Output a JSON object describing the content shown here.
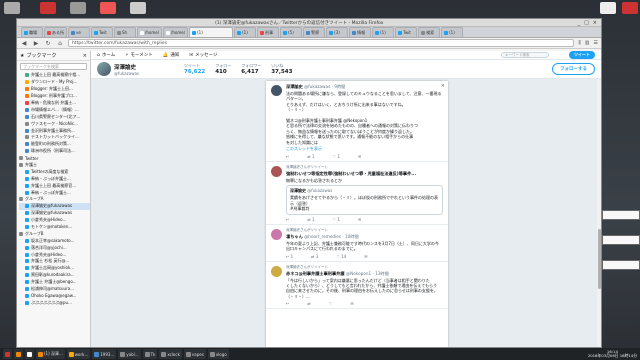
{
  "window": {
    "title": "(1) 深澤諭史@fukazawasさん／Twitterからの返信付きツイート - Mozilla Firefox"
  },
  "tabs": [
    {
      "label": "職場",
      "color": "#1da1f2"
    },
    {
      "label": "ある所",
      "color": "#e44"
    },
    {
      "label": "ve",
      "color": "#48c"
    },
    {
      "label": "Twit",
      "color": "#1da1f2"
    },
    {
      "label": "Sh",
      "color": "#888"
    },
    {
      "label": "/home/",
      "color": "#fff"
    },
    {
      "label": "/home/",
      "color": "#fff"
    },
    {
      "label": "(1)",
      "color": "#1da1f2",
      "active": true
    },
    {
      "label": "(1)",
      "color": "#1da1f2"
    },
    {
      "label": "刑事",
      "color": "#e44"
    },
    {
      "label": "(5)",
      "color": "#1da1f2"
    },
    {
      "label": "警察",
      "color": "#48c"
    },
    {
      "label": "(3)",
      "color": "#1da1f2"
    },
    {
      "label": "情報",
      "color": "#48c"
    },
    {
      "label": "(1)",
      "color": "#1da1f2"
    },
    {
      "label": "Twit",
      "color": "#1da1f2"
    },
    {
      "label": "検索",
      "color": "#888"
    },
    {
      "label": "(1)",
      "color": "#1da1f2"
    }
  ],
  "toolbar": {
    "url": "https://twitter.com/fukazawas/with_replies",
    "back": "◀",
    "forward": "▶",
    "reload": "↻",
    "home": "⌂"
  },
  "sidebar": {
    "title": "ブックマーク",
    "search_placeholder": "ブックマークを検索",
    "items": [
      {
        "label": "弁護士上田 最高検察庁相...",
        "color": "#4a8"
      },
      {
        "label": "ダウンロード - My Proj...",
        "color": "#fa0"
      },
      {
        "label": "Blogger: 弁護士上田...",
        "color": "#f70"
      },
      {
        "label": "Blogger: 刑事弁護ブロ...",
        "color": "#f70"
      },
      {
        "label": "奉納・危険な刑 弁護士...",
        "color": "#e44"
      },
      {
        "label": "市場情報エバ…（情報）...",
        "color": "#48c"
      },
      {
        "label": "石川県警察センター(北ア...",
        "color": "#48c"
      },
      {
        "label": "ヴァスモーク - NicoNic...",
        "color": "#888"
      },
      {
        "label": "金沢刑事弁護士事務所...",
        "color": "#48c"
      },
      {
        "label": "テストカットバックライ...",
        "color": "#888"
      },
      {
        "label": "能登町の刑務所対策...",
        "color": "#48c"
      },
      {
        "label": "珠洲市役所（刑事司法...",
        "color": "#48c"
      },
      {
        "label": "Twitter",
        "color": "#888",
        "folder": true
      },
      {
        "label": "弁護士",
        "color": "#888",
        "folder": true
      },
      {
        "label": "Twitterの高度な検索",
        "color": "#1da1f2"
      },
      {
        "label": "奉納・ぶっぽ弁護士...",
        "color": "#1da1f2"
      },
      {
        "label": "弁護士上田 最高検察官…",
        "color": "#1da1f2"
      },
      {
        "label": "奉納・ぶっぽ弁護士...",
        "color": "#1da1f2"
      },
      {
        "label": "グループA",
        "color": "#888",
        "folder": true
      },
      {
        "label": "深澤諭史@fukazawas",
        "color": "#1da1f2",
        "selected": true
      },
      {
        "label": "深澤諭史@fukazawas",
        "color": "#1da1f2"
      },
      {
        "label": "小倉秀夫@Hideo...",
        "color": "#1da1f2"
      },
      {
        "label": "モトケン@motoken...",
        "color": "#1da1f2"
      },
      {
        "label": "グループB",
        "color": "#888",
        "folder": true
      },
      {
        "label": "坂本正幸@sakamoto...",
        "color": "#1da1f2"
      },
      {
        "label": "落合洋司@yjochi...",
        "color": "#1da1f2"
      },
      {
        "label": "小倉秀夫@Hideo...",
        "color": "#1da1f2"
      },
      {
        "label": "弁護士 杉松 英行@...",
        "color": "#1da1f2"
      },
      {
        "label": "弁護士吉岡@yoshiok...",
        "color": "#1da1f2"
      },
      {
        "label": "黒田彰@kurodaakira...",
        "color": "#1da1f2"
      },
      {
        "label": "弁護士 弁護士@bengo...",
        "color": "#1da1f2"
      },
      {
        "label": "松浦伸司@matsuura...",
        "color": "#1da1f2"
      },
      {
        "label": "Ohoko Egawa@egaw...",
        "color": "#1da1f2"
      },
      {
        "label": "ぷぷぷぷぷぷぷ@pu...",
        "color": "#1da1f2"
      }
    ]
  },
  "twitter": {
    "nav": [
      {
        "icon": "⌂",
        "label": "ホーム"
      },
      {
        "icon": "⚡",
        "label": "モーメント"
      },
      {
        "icon": "🔔",
        "label": "通知"
      },
      {
        "icon": "✉",
        "label": "メッセージ"
      }
    ],
    "search_placeholder": "キーワード検索",
    "tweet_button": "ツイート",
    "profile": {
      "name": "深澤諭史",
      "handle": "@fukazawas",
      "stats": [
        {
          "label": "ツイート",
          "value": "76,622",
          "active": true
        },
        {
          "label": "フォロー",
          "value": "410"
        },
        {
          "label": "フォロワー",
          "value": "6,417"
        },
        {
          "label": "いいね",
          "value": "37,543"
        }
      ],
      "follow_button": "フォローする"
    },
    "thread_close": "×",
    "tweets": [
      {
        "context": "",
        "name": "深澤諭史",
        "meta": "@fukazawas · 9時間",
        "avatar": "#456",
        "body": "法の問題ある場所に嫌なら、登録してのキュウなることを思いまして、注意、一番現るパターン。\nとりあえず、だけはいく、とおちうけ所に出来る事はないですね。\n（・ゞ・）\n\n猫ネコ@刑事弁護士事刑事弁護 @Nekopon1\nと思る所で法律の交流を始めたものの、自種者への通報の対策に伝わりつ\nらく、無益な情報を送ったのに取てないほうことが何度か繰り返した。\n皆様にを得して、嫌な状態で思いです。通報不能のない相手からの仕事\nを対した知識には",
        "more": "このスレッドを表示",
        "actions": [
          "↩",
          "⇄ 1",
          "♡ 1",
          "✉"
        ]
      },
      {
        "context": "深澤諭史さんがリツイート",
        "name": "強制わいせつ等指定性罪(強制わいせつ罪・児童福祉法違反)等事件...",
        "meta": "",
        "avatar": "#a55",
        "body": "無罪になるかも応答されるとか",
        "quote": {
          "name": "深澤諭史",
          "meta": "@fukazawas",
          "body": "実績をあげさせてやるから（・ゞ）。ほぼ仮の刑務所でやれという事件の処理の表示（返答）\n#刑事裁判"
        },
        "actions": [
          "↩",
          "⇄ 1",
          "♡ 1",
          "✉"
        ]
      },
      {
        "context": "深澤諭史さんがリツイート",
        "name": "凛ちゃん",
        "meta": "@heart_remedies · 10時間",
        "avatar": "#c7a",
        "body": "今年の夏より上記、弁護士兼務可能です時代のンスを3月7日（土）、同日に大学の今\n出口キャンパスにて行われるのまでに。",
        "actions": [
          "↩ 1",
          "⇄ 3",
          "♡ 14",
          "✉"
        ]
      },
      {
        "context": "深澤諭史さんがリツイート",
        "name": "赤ネコ@刑事弁護士事刑事弁護",
        "meta": "@Nekopon1 · 13時間",
        "avatar": "#ca4",
        "body": "「今は行しいから」って案内は嫌悪に思ったんだけど（当事者は相手と関わりた\nくしたくないから）、どうしてもと言われたから、弁護士依頼で理由を伝えてもらう\n自由に来させたのに。その後、刑事の理由をお伝えしたのに怠らせは刑事の支援を。\n（・ゞ・）...",
        "actions": [
          "↩",
          "⇄",
          "♡",
          "✉"
        ]
      }
    ]
  },
  "taskbar": {
    "items": [
      {
        "label": "",
        "color": "#c33"
      },
      {
        "label": "",
        "color": "#e80"
      },
      {
        "label": "",
        "color": "#fff"
      },
      {
        "label": "(1) 深澤...",
        "color": "#e80"
      },
      {
        "label": "work...",
        "color": "#fa0"
      },
      {
        "label": "1993...",
        "color": "#48c"
      },
      {
        "label": "yabl...",
        "color": "#888"
      },
      {
        "label": "Tk",
        "color": "#888"
      },
      {
        "label": "xclock",
        "color": "#888"
      },
      {
        "label": "vapes",
        "color": "#888"
      },
      {
        "label": "xlogo",
        "color": "#888"
      }
    ],
    "clock_time": "16:14",
    "clock_date": "2018年03月06日 18時14分"
  }
}
